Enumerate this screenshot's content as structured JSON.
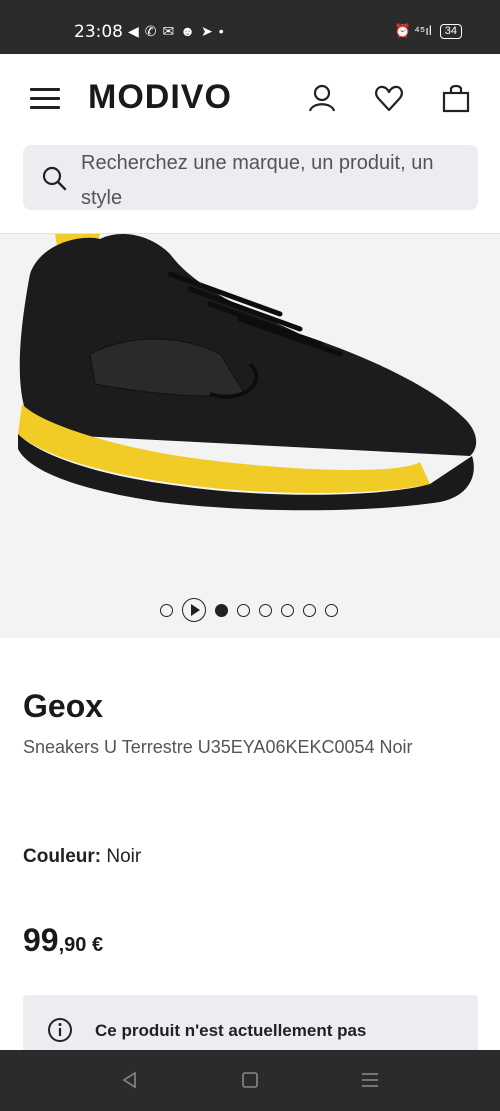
{
  "status_bar": {
    "time": "23:08",
    "notifications": [
      "◀",
      "✆",
      "✉",
      "☻",
      "➤",
      "•"
    ],
    "signal": "⏰ ⁴⁵ıl",
    "battery": "34"
  },
  "header": {
    "logo": "MODIVO",
    "icons": [
      "menu-icon",
      "user-icon",
      "heart-icon",
      "bag-icon"
    ]
  },
  "search": {
    "placeholder": "Recherchez une marque, un produit, un style"
  },
  "gallery": {
    "image_count": 6,
    "active_index": 0
  },
  "product": {
    "brand": "Geox",
    "name": "Sneakers U Terrestre U35EYA06KEKC0054 Noir",
    "color_label": "Couleur:",
    "color_value": "Noir",
    "price_int": "99",
    "price_dec": ",90 €"
  },
  "notice": {
    "text": "Ce produit n'est actuellement pas"
  },
  "colors": {
    "sole": "#f2cc26",
    "shoe": "#1a1a1a",
    "bar": "#2b2b2b"
  }
}
